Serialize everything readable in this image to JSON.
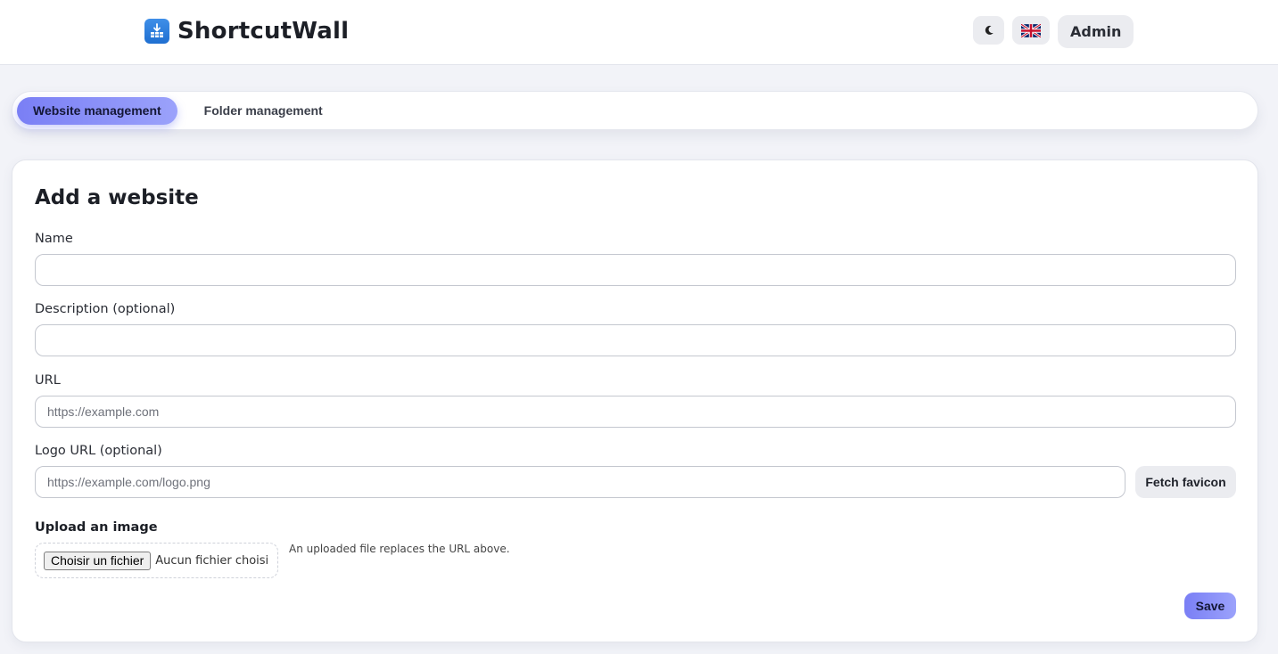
{
  "header": {
    "app_name": "ShortcutWall",
    "logo_icon": "download-grid-icon",
    "theme_toggle_icon": "moon-icon",
    "language_icon": "uk-flag-icon",
    "admin_label": "Admin"
  },
  "tabs": [
    {
      "label": "Website management",
      "active": true
    },
    {
      "label": "Folder management",
      "active": false
    }
  ],
  "form": {
    "title": "Add a website",
    "name": {
      "label": "Name",
      "value": "",
      "placeholder": ""
    },
    "description": {
      "label": "Description (optional)",
      "value": "",
      "placeholder": ""
    },
    "url": {
      "label": "URL",
      "value": "",
      "placeholder": "https://example.com"
    },
    "logo_url": {
      "label": "Logo URL (optional)",
      "value": "",
      "placeholder": "https://example.com/logo.png"
    },
    "fetch_favicon_label": "Fetch favicon",
    "upload": {
      "label": "Upload an image",
      "button_label": "Choisir un fichier",
      "status": "Aucun fichier choisi",
      "hint": "An uploaded file replaces the URL above."
    },
    "save_label": "Save"
  },
  "colors": {
    "accent": "#7a7ff5",
    "background": "#f2f3f8",
    "logo": "#2f80e0"
  }
}
